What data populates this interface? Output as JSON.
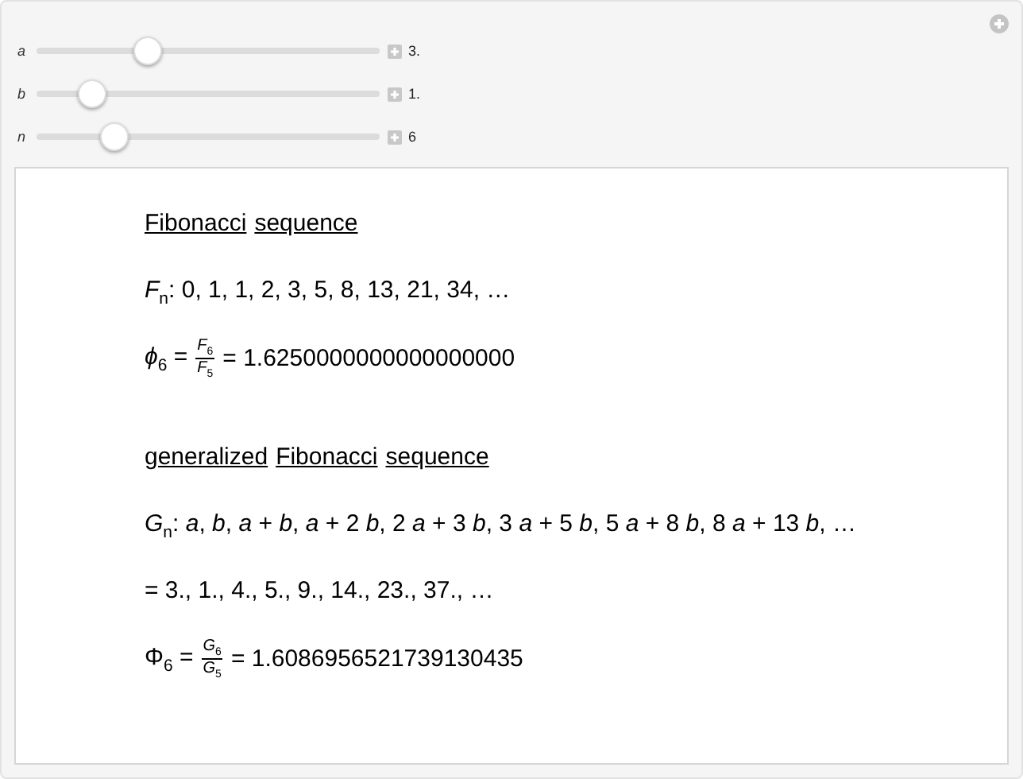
{
  "controls": [
    {
      "label": "a",
      "value": "3.",
      "level": 0.31
    },
    {
      "label": "b",
      "value": "1.",
      "level": 0.13
    },
    {
      "label": "n",
      "value": "6",
      "level": 0.2
    }
  ],
  "output": {
    "fibonacci": {
      "heading": [
        "Fibonacci",
        "sequence"
      ],
      "sequence": "*F*$_{n}$: 0, 1, 1, 2, 3, 5, 8, 13, 21, 34, …",
      "ratio": {
        "lhs": "*ϕ*$_{6}$ =",
        "numerator": "*F*$_{6}$",
        "denominator": "*F*$_{5}$",
        "value": "= 1.6250000000000000000"
      }
    },
    "generalized": {
      "heading": [
        "generalized",
        "Fibonacci",
        "sequence"
      ],
      "sequence": "*G*$_{n}$: *a*, *b*, *a* + *b*, *a* + 2 *b*, 2 *a* + 3 *b*, 3 *a* + 5 *b*, 5 *a* + 8 *b*, 8 *a* + 13 *b*, …",
      "values": "= 3., 1., 4., 5., 9., 14., 23., 37., …",
      "ratio": {
        "lhs": "Φ$_{6}$ =",
        "numerator": "*G*$_{6}$",
        "denominator": "*G*$_{5}$",
        "value": "= 1.6086956521739130435"
      }
    }
  }
}
